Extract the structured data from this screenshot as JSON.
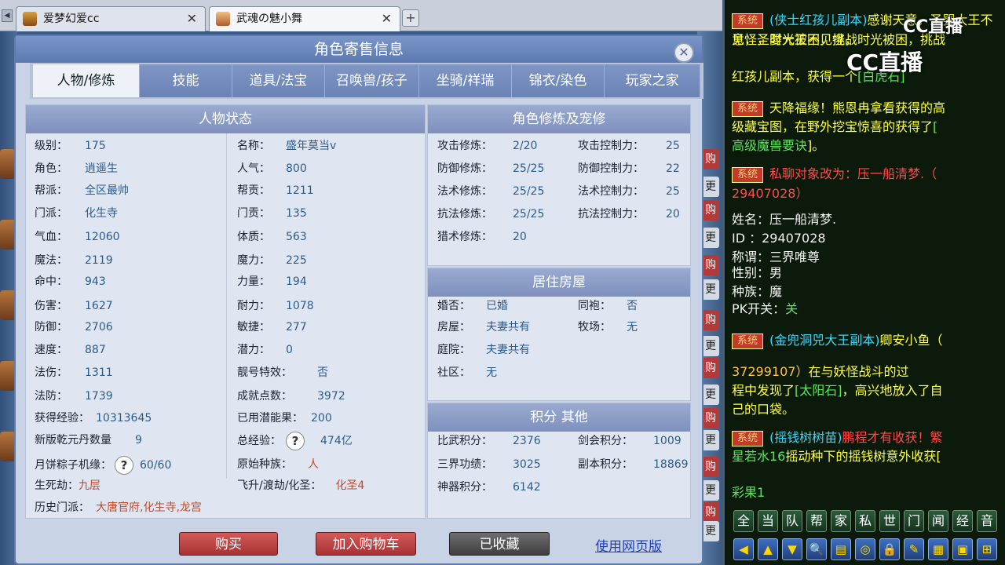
{
  "browser": {
    "tabs": [
      {
        "title": "爱梦幻爱cc",
        "close": "✕"
      },
      {
        "title": "武魂の魅小舞",
        "close": "✕"
      }
    ],
    "new_tab": "+",
    "tab_scroll": "◀"
  },
  "dialog": {
    "title": "角色寄售信息",
    "close": "✕",
    "tabs": [
      "人物/修炼",
      "技能",
      "道具/法宝",
      "召唤兽/孩子",
      "坐骑/祥瑞",
      "锦衣/染色",
      "玩家之家"
    ],
    "status": {
      "heading": "人物状态",
      "left": [
        {
          "k": "级别：",
          "v": "175"
        },
        {
          "k": "角色：",
          "v": "逍遥生"
        },
        {
          "k": "帮派：",
          "v": "全区最帅"
        },
        {
          "k": "门派：",
          "v": "化生寺"
        },
        {
          "k": "气血：",
          "v": "12060"
        },
        {
          "k": "魔法：",
          "v": "2119"
        },
        {
          "k": "命中：",
          "v": "943"
        },
        {
          "k": "伤害：",
          "v": "1627"
        },
        {
          "k": "防御：",
          "v": "2706"
        },
        {
          "k": "速度：",
          "v": "887"
        },
        {
          "k": "法伤：",
          "v": "1311"
        },
        {
          "k": "法防：",
          "v": "1739"
        }
      ],
      "right": [
        {
          "k": "名称：",
          "v": "盛年莫当v"
        },
        {
          "k": "人气：",
          "v": "800"
        },
        {
          "k": "帮贡：",
          "v": "1211"
        },
        {
          "k": "门贡：",
          "v": "135"
        },
        {
          "k": "体质：",
          "v": "563"
        },
        {
          "k": "魔力：",
          "v": "225"
        },
        {
          "k": "力量：",
          "v": "194"
        },
        {
          "k": "耐力：",
          "v": "1078"
        },
        {
          "k": "敏捷：",
          "v": "277"
        },
        {
          "k": "潜力：",
          "v": "0"
        },
        {
          "k": "靓号特效：",
          "v": "否"
        },
        {
          "k": "成就点数：",
          "v": "3972"
        }
      ],
      "exp_label": "获得经验：",
      "exp_value": "10313645",
      "used_fruit_label": "已用潜能果：",
      "used_fruit_value": "200",
      "qianyuan_label": "新版乾元丹数量",
      "qianyuan_value": "9",
      "total_exp_label": "总经验：",
      "total_exp_value": "474亿",
      "zongzi_label": "月饼粽子机缘：",
      "zongzi_value": "60/60",
      "origin_label": "原始种族：",
      "origin_value": "人",
      "shengsi_label": "生死劫：",
      "shengsi_value": "九层",
      "feisheng_label": "飞升/渡劫/化圣：",
      "feisheng_value": "化圣4",
      "history_label": "历史门派：",
      "history_value": "大唐官府,化生寺,龙宫",
      "help": "?"
    },
    "cultivation": {
      "heading": "角色修炼及宠修",
      "left": [
        {
          "k": "攻击修炼：",
          "v": "2/20"
        },
        {
          "k": "防御修炼：",
          "v": "25/25"
        },
        {
          "k": "法术修炼：",
          "v": "25/25"
        },
        {
          "k": "抗法修炼：",
          "v": "25/25"
        },
        {
          "k": "猎术修炼：",
          "v": "20"
        }
      ],
      "right": [
        {
          "k": "攻击控制力：",
          "v": "25"
        },
        {
          "k": "防御控制力：",
          "v": "22"
        },
        {
          "k": "法术控制力：",
          "v": "25"
        },
        {
          "k": "抗法控制力：",
          "v": "20"
        }
      ]
    },
    "housing": {
      "heading": "居住房屋",
      "left": [
        {
          "k": "婚否：",
          "v": "已婚"
        },
        {
          "k": "房屋：",
          "v": "夫妻共有"
        },
        {
          "k": "庭院：",
          "v": "夫妻共有"
        },
        {
          "k": "社区：",
          "v": "无"
        }
      ],
      "right": [
        {
          "k": "同袍：",
          "v": "否"
        },
        {
          "k": "牧场：",
          "v": "无"
        }
      ]
    },
    "points": {
      "heading": "积分 其他",
      "left": [
        {
          "k": "比武积分：",
          "v": "2376"
        },
        {
          "k": "三界功绩：",
          "v": "3025"
        },
        {
          "k": "神器积分：",
          "v": "6142"
        }
      ],
      "right": [
        {
          "k": "剑会积分：",
          "v": "1009"
        },
        {
          "k": "副本积分：",
          "v": "18869"
        }
      ]
    },
    "buttons": {
      "buy": "购买",
      "add_cart": "加入购物车",
      "favorited": "已收藏",
      "web": "使用网页版"
    }
  },
  "game_right_buttons": [
    "购",
    "更",
    "购",
    "更",
    "购",
    "更",
    "购",
    "更",
    "购",
    "更",
    "购",
    "更",
    "购",
    "更",
    "购",
    "更",
    "购",
    "更"
  ],
  "chat": {
    "badge": "系统",
    "logo": "CC直播",
    "lines": [
      {
        "a": "(侠士红孩儿副本)",
        "b": "感谢天意，圣婴大王不见怪，时光被困，挑战"
      },
      {
        "a": "意，圣婴大王不见怪，时光被困，挑战",
        "b": ""
      },
      {
        "a": "红孩儿副本，获得一个",
        "b": "[白虎石]"
      },
      {
        "a": "天降福缘！",
        "b": "熊恩冉拿看获得的高"
      },
      {
        "a": "级藏宝图，在野外挖宝惊喜的获得了",
        "b": "["
      },
      {
        "a": "高级魔兽要诀",
        "b": "]。"
      },
      {
        "a": "私聊对象改为：压一船清梦.（",
        "b": ""
      },
      {
        "a": "29407028）",
        "b": ""
      },
      {
        "a": "姓名：压一船清梦.",
        "b": ""
      },
      {
        "a": "ID  ：29407028",
        "b": ""
      },
      {
        "a": "称谓：三界唯尊",
        "b": ""
      },
      {
        "a": "性别：男",
        "b": ""
      },
      {
        "a": "种族：魔",
        "b": ""
      },
      {
        "a": "PK开关：",
        "b": "关"
      },
      {
        "a": "(金兜洞兕大王副本)",
        "b": "卿安小鱼（"
      },
      {
        "a": "37299107）",
        "b": "在与妖怪战斗的过"
      },
      {
        "a": "程中发现了",
        "b": "[太阳石]"
      },
      {
        "a": "，高兴地放入了自",
        "b": ""
      },
      {
        "a": "己的口袋。",
        "b": ""
      },
      {
        "a": "(摇钱树树苗)",
        "b": "鹏程才有收获！繁"
      },
      {
        "a": "星若水16",
        "b": "摇动种下的摇钱树意外收获["
      },
      {
        "a": "彩果1",
        "b": ""
      }
    ],
    "toolbar1": [
      "全",
      "当",
      "队",
      "帮",
      "家",
      "私",
      "世",
      "门",
      "闻",
      "经",
      "音"
    ],
    "toolbar2": [
      "◀",
      "▲",
      "▼",
      "🔍",
      "▤",
      "◎",
      "🔒",
      "✎",
      "▦",
      "▣",
      "⊞"
    ]
  }
}
